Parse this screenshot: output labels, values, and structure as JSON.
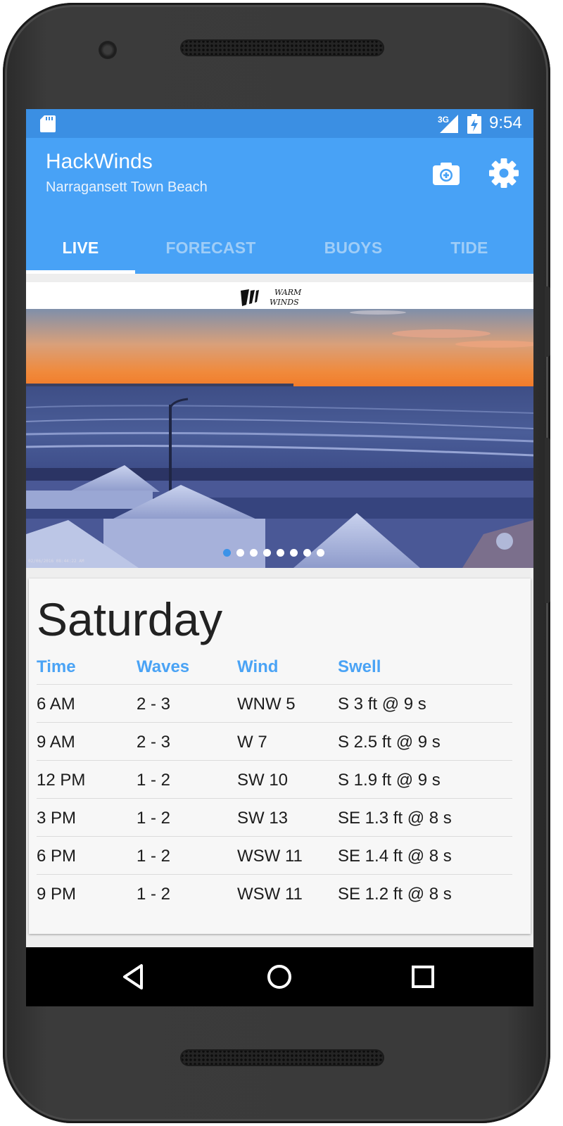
{
  "status_bar": {
    "network": "3G",
    "time": "9:54"
  },
  "app_bar": {
    "title": "HackWinds",
    "subtitle": "Narragansett Town Beach",
    "actions": {
      "camera": "camera-icon",
      "settings": "gear-icon"
    }
  },
  "tabs": [
    {
      "label": "LIVE",
      "selected": true
    },
    {
      "label": "FORECAST",
      "selected": false
    },
    {
      "label": "BUOYS",
      "selected": false
    },
    {
      "label": "TIDE",
      "selected": false
    }
  ],
  "live_camera": {
    "logo_text": "WARM WINDS",
    "timestamp": "02/06/2016 08:44:22 AM",
    "pages": 8,
    "current_page": 1
  },
  "forecast": {
    "day": "Saturday",
    "columns": [
      "Time",
      "Waves",
      "Wind",
      "Swell"
    ],
    "rows": [
      [
        "6 AM",
        "2 - 3",
        "WNW 5",
        "S 3 ft @ 9 s"
      ],
      [
        "9 AM",
        "2 - 3",
        "W 7",
        "S 2.5 ft @ 9 s"
      ],
      [
        "12 PM",
        "1 - 2",
        "SW 10",
        "S 1.9 ft @ 9 s"
      ],
      [
        "3 PM",
        "1 - 2",
        "SW 13",
        "SE 1.3 ft @ 8 s"
      ],
      [
        "6 PM",
        "1 - 2",
        "WSW 11",
        "SE 1.4 ft @ 8 s"
      ],
      [
        "9 PM",
        "1 - 2",
        "WSW 11",
        "SE 1.2 ft @ 8 s"
      ]
    ]
  },
  "nav_bar": {
    "back": "back-triangle-icon",
    "home": "home-circle-icon",
    "recents": "recents-square-icon"
  },
  "colors": {
    "status_bar": "#3b8fe3",
    "app_bar": "#48a2f6",
    "accent": "#4aa3f5",
    "inactive_tab": "#9fcdf7"
  }
}
